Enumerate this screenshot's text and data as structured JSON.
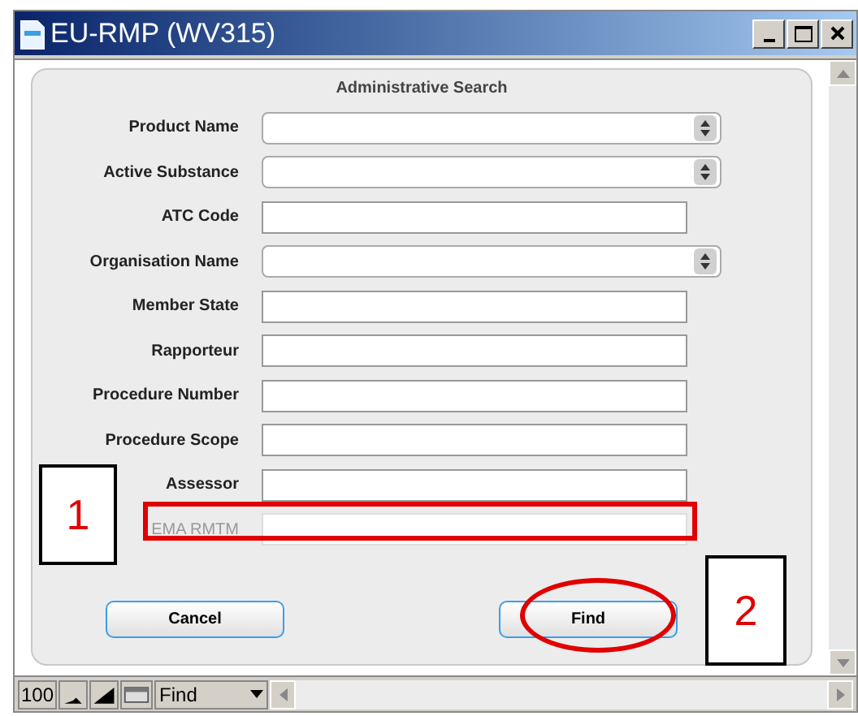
{
  "window": {
    "title": "EU-RMP (WV315)"
  },
  "panel": {
    "title": "Administrative Search"
  },
  "fields": [
    {
      "label": "Product Name",
      "kind": "dropdown",
      "disabled": false
    },
    {
      "label": "Active Substance",
      "kind": "dropdown",
      "disabled": false
    },
    {
      "label": "ATC Code",
      "kind": "text",
      "disabled": false
    },
    {
      "label": "Organisation Name",
      "kind": "dropdown",
      "disabled": false
    },
    {
      "label": "Member State",
      "kind": "text",
      "disabled": false
    },
    {
      "label": "Rapporteur",
      "kind": "text",
      "disabled": false
    },
    {
      "label": "Procedure Number",
      "kind": "text",
      "disabled": false
    },
    {
      "label": "Procedure Scope",
      "kind": "text",
      "disabled": false
    },
    {
      "label": "Assessor",
      "kind": "text",
      "disabled": false
    },
    {
      "label": "EMA RMTM",
      "kind": "text",
      "disabled": true
    }
  ],
  "buttons": [
    "Cancel",
    "Find"
  ],
  "annotations": [
    {
      "kind": "box",
      "label": "1"
    },
    {
      "kind": "outline"
    },
    {
      "kind": "ellipse"
    },
    {
      "kind": "box",
      "label": "2"
    }
  ],
  "status_bar": {
    "zoom": "100",
    "mode": "Find"
  }
}
